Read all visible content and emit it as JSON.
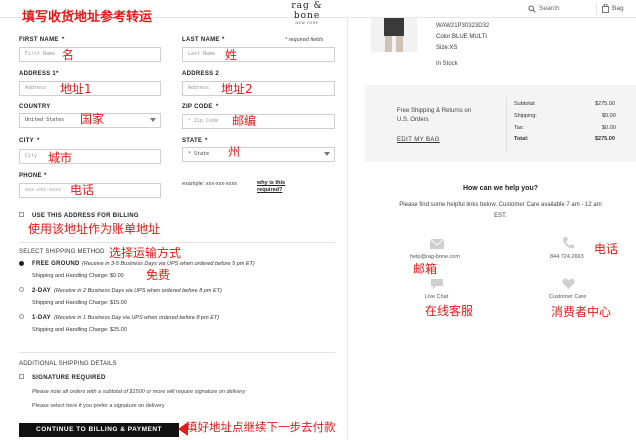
{
  "header": {
    "brand": "rag & bone",
    "brand_sub": "NEW YORK",
    "search_placeholder": "Search",
    "bag_label": "Bag"
  },
  "annotations": {
    "title": "填写收货地址参考转运",
    "first_name": "名",
    "last_name": "姓",
    "address1": "地址1",
    "address2": "地址2",
    "country": "国家",
    "zip": "邮编",
    "city": "城市",
    "state": "州",
    "phone": "电话",
    "billing_same": "使用该地址作为账单地址",
    "shipping_method": "选择运输方式",
    "free": "免费",
    "email": "邮箱",
    "live_chat": "在线客服",
    "phone_right": "电话",
    "customer_care": "消费者中心",
    "continue": "填好地址点继续下一步去付款"
  },
  "form": {
    "first_name_label": "FIRST NAME",
    "last_name_label": "LAST NAME",
    "required_note": "* required fields",
    "first_name_placeholder": "First Name",
    "last_name_placeholder": "Last Name",
    "address1_label": "ADDRESS 1",
    "address2_label": "ADDRESS 2",
    "address1_placeholder": "Address",
    "address2_placeholder": "Address",
    "country_label": "COUNTRY",
    "country_value": "United States",
    "zip_label": "ZIP CODE",
    "zip_placeholder": "* Zip Code",
    "city_label": "CITY",
    "city_placeholder": "City",
    "state_label": "STATE",
    "state_value": "* State",
    "phone_label": "PHONE",
    "phone_placeholder": "xxx-xxx-xxxx",
    "phone_example": "example: xxx-xxx-xxxx",
    "why_link": "why is this required?",
    "use_billing": "USE THIS ADDRESS FOR BILLING"
  },
  "shipping": {
    "section_label": "SELECT SHIPPING METHOD",
    "options": [
      {
        "name": "FREE GROUND",
        "desc": "(Receive in 3-5 Business Days via UPS when ordered before 5 pm ET)",
        "charge": "Shipping and Handling Charge: $0.00"
      },
      {
        "name": "2-DAY",
        "desc": "(Receive in 2 Business Days via UPS when ordered before 8 pm ET)",
        "charge": "Shipping and Handling Charge: $15.00"
      },
      {
        "name": "1-DAY",
        "desc": "(Receive in 1 Business Day via UPS when ordered before 8 pm ET)",
        "charge": "Shipping and Handling Charge: $25.00"
      }
    ],
    "additional_label": "ADDITIONAL SHIPPING DETAILS",
    "signature_label": "SIGNATURE REQUIRED",
    "signature_note1": "Please note all orders with a subtotal of $1500 or more will require signature on delivery",
    "signature_note2": "Please select here if you prefer a signature on delivery",
    "continue_button": "CONTINUE TO BILLING & PAYMENT"
  },
  "product": {
    "sku": "WAW21P30323D32",
    "color": "Color:BLUE MULTI",
    "size": "Size:XS",
    "stock": "In Stock"
  },
  "summary": {
    "free_shipping_line1": "Free Shipping & Returns on",
    "free_shipping_line2": "U.S. Orders",
    "edit_bag": "EDIT MY BAG",
    "rows": [
      {
        "label": "Subtotal:",
        "value": "$275.00"
      },
      {
        "label": "Shipping:",
        "value": "$0.00"
      },
      {
        "label": "Tax:",
        "value": "$0.00"
      },
      {
        "label": "Total:",
        "value": "$275.00"
      }
    ]
  },
  "help": {
    "title": "How can we help you?",
    "subtitle_line1": "Please find some helpful links below. Customer Care available 7 am - 12 am",
    "subtitle_line2": "EST.",
    "email": "help@rag-bone.com",
    "phone": "844.724.2663",
    "live_chat": "Live Chat",
    "customer_care": "Customer Care"
  },
  "colors": {
    "annotation_red": "#e21b1b",
    "button_black": "#111111",
    "panel_gray": "#f4f4f4"
  }
}
